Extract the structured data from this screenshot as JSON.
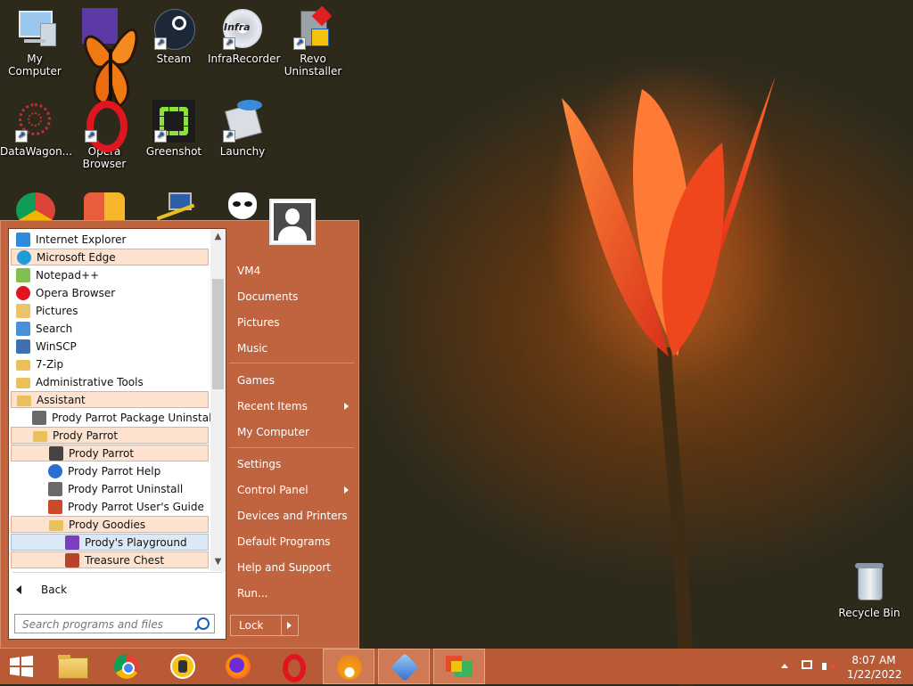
{
  "desktop": {
    "icons": [
      {
        "label": "My Computer"
      },
      {
        "label": "Steam"
      },
      {
        "label": "InfraRecorder"
      },
      {
        "label": "Revo Uninstaller"
      },
      {
        "label": "DataWagon..."
      },
      {
        "label": "Opera Browser"
      },
      {
        "label": "Greenshot"
      },
      {
        "label": "Launchy"
      },
      {
        "label": "Recycle Bin"
      }
    ]
  },
  "start_menu": {
    "programs": [
      {
        "label": "Internet Explorer",
        "indent": 0,
        "state": "normal",
        "icon": "ie-icon"
      },
      {
        "label": "Microsoft Edge",
        "indent": 0,
        "state": "highlight",
        "icon": "edge-icon"
      },
      {
        "label": "Notepad++",
        "indent": 0,
        "state": "normal",
        "icon": "notepad-icon"
      },
      {
        "label": "Opera Browser",
        "indent": 0,
        "state": "normal",
        "icon": "opera-icon"
      },
      {
        "label": "Pictures",
        "indent": 0,
        "state": "normal",
        "icon": "pictures-icon"
      },
      {
        "label": "Search",
        "indent": 0,
        "state": "normal",
        "icon": "search-icon"
      },
      {
        "label": "WinSCP",
        "indent": 0,
        "state": "normal",
        "icon": "winscp-icon"
      },
      {
        "label": "7-Zip",
        "indent": 0,
        "state": "normal",
        "icon": "folder-icon"
      },
      {
        "label": "Administrative Tools",
        "indent": 0,
        "state": "normal",
        "icon": "folder-icon"
      },
      {
        "label": "Assistant",
        "indent": 0,
        "state": "highlight",
        "icon": "folder-icon"
      },
      {
        "label": "Prody Parrot Package Uninstall",
        "indent": 1,
        "state": "normal",
        "icon": "uninstall-icon"
      },
      {
        "label": "Prody Parrot",
        "indent": 1,
        "state": "highlight",
        "icon": "folder-icon"
      },
      {
        "label": "Prody Parrot",
        "indent": 2,
        "state": "highlight",
        "icon": "parrot-icon"
      },
      {
        "label": "Prody Parrot Help",
        "indent": 2,
        "state": "normal",
        "icon": "help-icon"
      },
      {
        "label": "Prody Parrot Uninstall",
        "indent": 2,
        "state": "normal",
        "icon": "uninstall-icon"
      },
      {
        "label": "Prody Parrot User's Guide",
        "indent": 2,
        "state": "normal",
        "icon": "guide-icon"
      },
      {
        "label": "Prody Goodies",
        "indent": 2,
        "state": "highlight",
        "icon": "folder-icon"
      },
      {
        "label": "Prody's Playground",
        "indent": 3,
        "state": "selected",
        "icon": "playground-icon"
      },
      {
        "label": "Treasure Chest",
        "indent": 3,
        "state": "highlight",
        "icon": "treasure-icon"
      }
    ],
    "back_label": "Back",
    "search_placeholder": "Search programs and files",
    "right_items": [
      {
        "label": "VM4",
        "submenu": false
      },
      {
        "label": "Documents",
        "submenu": false
      },
      {
        "label": "Pictures",
        "submenu": false
      },
      {
        "label": "Music",
        "submenu": false
      },
      {
        "label": "Games",
        "submenu": false
      },
      {
        "label": "Recent Items",
        "submenu": true
      },
      {
        "label": "My Computer",
        "submenu": false
      },
      {
        "label": "Settings",
        "submenu": false
      },
      {
        "label": "Control Panel",
        "submenu": true
      },
      {
        "label": "Devices and Printers",
        "submenu": false
      },
      {
        "label": "Default Programs",
        "submenu": false
      },
      {
        "label": "Help and Support",
        "submenu": false
      },
      {
        "label": "Run...",
        "submenu": false
      }
    ],
    "lock_label": "Lock"
  },
  "taskbar": {
    "buttons": [
      {
        "name": "windows-start-icon"
      },
      {
        "name": "file-explorer-icon"
      },
      {
        "name": "chrome-icon"
      },
      {
        "name": "keepass-icon"
      },
      {
        "name": "firefox-icon"
      },
      {
        "name": "opera-icon"
      },
      {
        "name": "prody-parrot-icon",
        "active": true
      },
      {
        "name": "launchy-icon",
        "active": true
      },
      {
        "name": "speech-app-icon",
        "active": true
      }
    ],
    "time": "8:07 AM",
    "date": "1/22/2022"
  },
  "colors": {
    "menu_bg": "#c0643f",
    "taskbar_bg": "#b75a35",
    "highlight_bg": "#fde3cf",
    "selected_bg": "#dbe9f7"
  }
}
